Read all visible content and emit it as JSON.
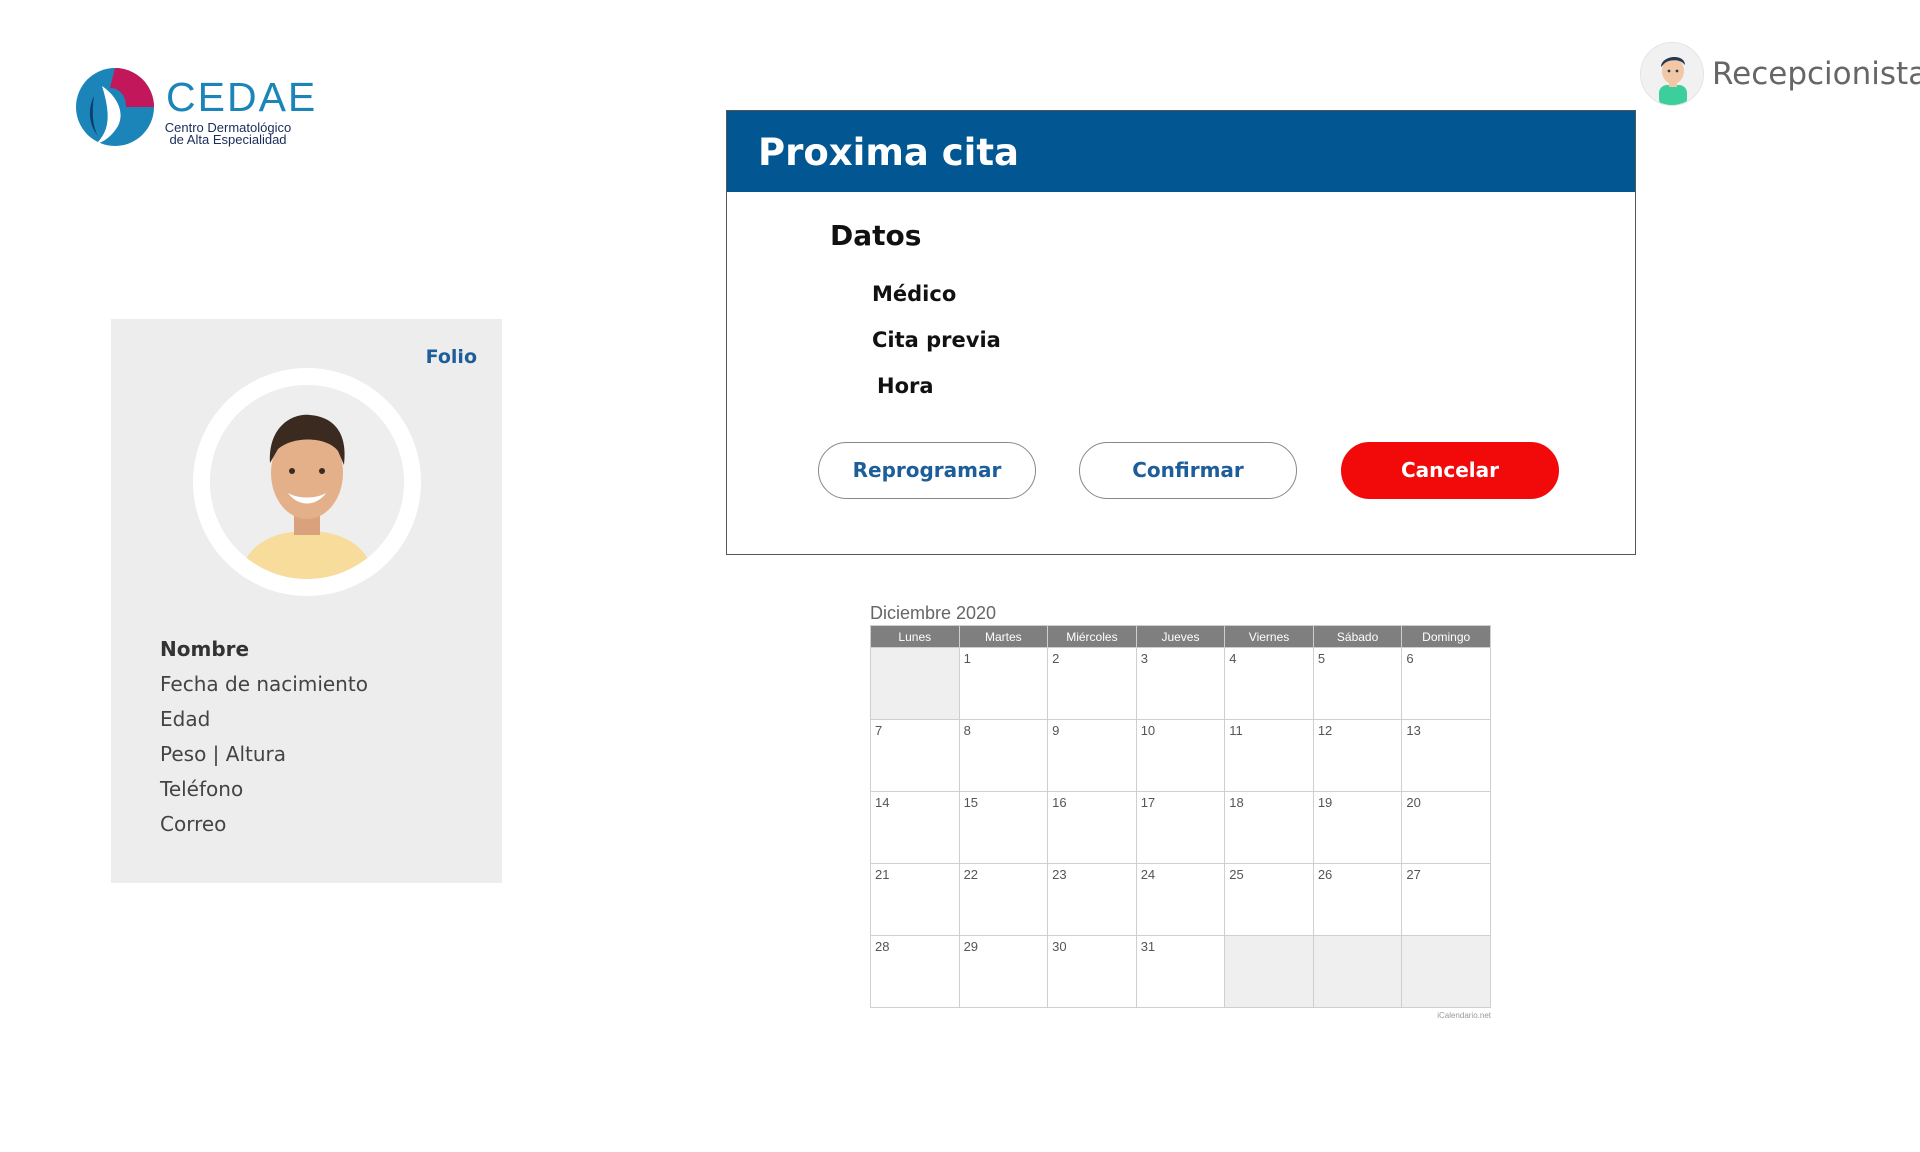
{
  "logo": {
    "name": "CEDAE",
    "subtitle_line1": "Centro Dermatológico",
    "subtitle_line2": "de Alta Especialidad"
  },
  "user": {
    "role": "Recepcionista",
    "avatar_icon": "user-avatar-icon"
  },
  "patient": {
    "folio_label": "Folio",
    "photo_icon": "patient-photo",
    "fields": [
      "Nombre",
      "Fecha de nacimiento",
      "Edad",
      "Peso | Altura",
      "Teléfono",
      "Correo"
    ]
  },
  "appointment": {
    "title": "Proxima cita",
    "section_title": "Datos",
    "fields": [
      "Médico",
      "Cita previa",
      "Hora"
    ],
    "buttons": {
      "reschedule": "Reprogramar",
      "confirm": "Confirmar",
      "cancel": "Cancelar"
    },
    "colors": {
      "header": "#025692",
      "cancel": "#f20a0a",
      "link": "#1c5d9a"
    }
  },
  "calendar": {
    "title": "Diciembre 2020",
    "weekdays": [
      "Lunes",
      "Martes",
      "Miércoles",
      "Jueves",
      "Viernes",
      "Sábado",
      "Domingo"
    ],
    "weeks": [
      [
        "",
        "1",
        "2",
        "3",
        "4",
        "5",
        "6"
      ],
      [
        "7",
        "8",
        "9",
        "10",
        "11",
        "12",
        "13"
      ],
      [
        "14",
        "15",
        "16",
        "17",
        "18",
        "19",
        "20"
      ],
      [
        "21",
        "22",
        "23",
        "24",
        "25",
        "26",
        "27"
      ],
      [
        "28",
        "29",
        "30",
        "31",
        "",
        "",
        ""
      ]
    ],
    "footer": "iCalendario.net"
  }
}
